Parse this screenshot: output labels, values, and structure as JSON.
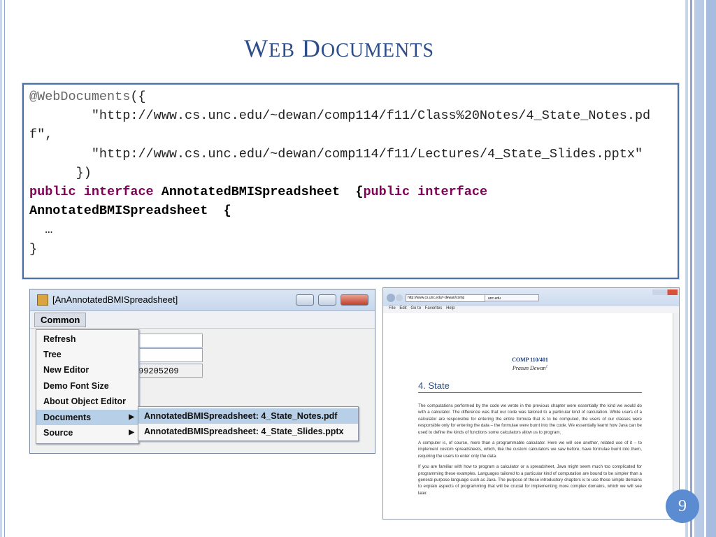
{
  "slide": {
    "title_first": "W",
    "title_first_rest": "EB",
    "title_second": "D",
    "title_second_rest": "OCUMENTS",
    "page_number": "9"
  },
  "code": {
    "line1_annotation": "@WebDocuments",
    "line1_paren": "({",
    "url1": "\"http://www.cs.unc.edu/~dewan/comp114/f11/Class%20Notes/4_State_Notes.pdf\"",
    "comma": ",",
    "url2": "\"http://www.cs.unc.edu/~dewan/comp114/f11/Lectures/4_State_Slides.pptx\"",
    "close": "})",
    "kw_public": "public",
    "kw_interface": "interface",
    "type_name": "AnnotatedBMISpreadsheet",
    "brace": "{",
    "ellipsis": "…",
    "end_brace": "}"
  },
  "swing": {
    "title": "[AnAnnotatedBMISpreadsheet]",
    "menu": "Common",
    "field_value": "99205209",
    "menu_items": [
      "Refresh",
      "Tree",
      "New Editor",
      "Demo Font Size",
      "About Object Editor",
      "Documents",
      "Source"
    ],
    "submenu_items": [
      "AnnotatedBMISpreadsheet: 4_State_Notes.pdf",
      "AnnotatedBMISpreadsheet: 4_State_Slides.pptx"
    ]
  },
  "browser": {
    "address": "http://www.cs.unc.edu/~dewan/comp",
    "tab": "unc.edu",
    "menu": [
      "File",
      "Edit",
      "Go to",
      "Favorites",
      "Help"
    ],
    "course": "COMP 110/401",
    "author": "Prasun Dewan",
    "footnote_mark": "1",
    "heading": "4. State",
    "paragraphs": [
      "The computations performed by the code we wrote in the previous chapter were essentially the kind we would do with a calculator. The difference was that our code was tailored to a particular kind of calculation. While users of a calculator are responsible for entering the entire formula that is to be computed, the users of our classes were responsible only for entering the data – the formulae were burnt into the code. We essentially learnt how Java can be used to define the kinds of functions some calculators allow us to program.",
      "A computer is, of course, more than a programmable calculator. Here we will see another, related use of it – to implement custom spreadsheets, which, like the custom calculators we saw before, have formulae burnt into them, requiring the users to enter only the data.",
      "If you are familiar with how to program a calculator or a spreadsheet, Java might seem much too complicated for programming these examples. Languages tailored to a particular kind of computation are bound to be simpler than a general-purpose language such as Java. The purpose of these introductory chapters is to use these simple domains to explain aspects of programming that will be crucial for implementing more complex domains, which we will see later."
    ]
  }
}
